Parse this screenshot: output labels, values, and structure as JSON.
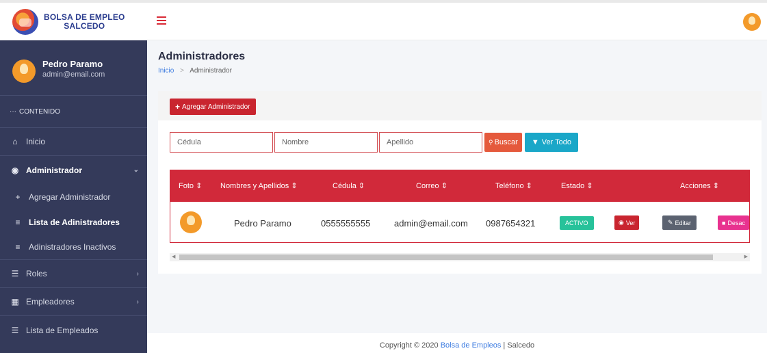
{
  "brand": {
    "line1": "BOLSA DE EMPLEO",
    "line2": "SALCEDO"
  },
  "user": {
    "name": "Pedro Paramo",
    "email": "admin@email.com"
  },
  "sidebar": {
    "section": "CONTENIDO",
    "items": [
      {
        "label": "Inicio",
        "icon": "home-icon"
      },
      {
        "label": "Administrador",
        "icon": "user-circle-icon"
      },
      {
        "label": "Agregar Administrador",
        "icon": "plus-icon"
      },
      {
        "label": "Lista de Adinistradores",
        "icon": "list-icon"
      },
      {
        "label": "Adinistradores Inactivos",
        "icon": "list-icon"
      },
      {
        "label": "Roles",
        "icon": "roles-icon"
      },
      {
        "label": "Empleadores",
        "icon": "building-icon"
      },
      {
        "label": "Lista de Empleados",
        "icon": "list-icon"
      }
    ]
  },
  "page": {
    "title": "Administradores",
    "breadcrumb": {
      "home": "Inicio",
      "current": "Administrador"
    }
  },
  "actions": {
    "add_label": "Agregar Administrador"
  },
  "filters": {
    "cedula_placeholder": "Cédula",
    "nombre_placeholder": "Nombre",
    "apellido_placeholder": "Apellido",
    "buscar_label": "Buscar",
    "vertodo_label": "Ver Todo"
  },
  "table": {
    "headers": [
      "Foto",
      "Nombres y Apellidos",
      "Cédula",
      "Correo",
      "Teléfono",
      "Estado",
      "Acciones"
    ],
    "rows": [
      {
        "nombre": "Pedro Paramo",
        "cedula": "0555555555",
        "correo": "admin@email.com",
        "telefono": "0987654321",
        "estado": "ACTIVO",
        "ver": "Ver",
        "editar": "Editar",
        "desactivar": "Desac"
      }
    ]
  },
  "footer": {
    "prefix": "Copyright © 2020 ",
    "link": "Bolsa de Empleos",
    "suffix": " | Salcedo"
  },
  "colors": {
    "primary_red": "#c9252f",
    "sidebar": "#343a5a",
    "success": "#27c29a",
    "info": "#1aa7c8",
    "pink": "#e8328f"
  }
}
